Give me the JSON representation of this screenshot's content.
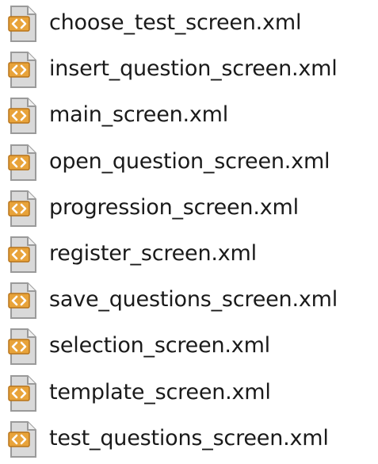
{
  "files": [
    {
      "name": "choose_test_screen.xml",
      "icon": "xml-file-icon"
    },
    {
      "name": "insert_question_screen.xml",
      "icon": "xml-file-icon"
    },
    {
      "name": "main_screen.xml",
      "icon": "xml-file-icon"
    },
    {
      "name": "open_question_screen.xml",
      "icon": "xml-file-icon"
    },
    {
      "name": "progression_screen.xml",
      "icon": "xml-file-icon"
    },
    {
      "name": "register_screen.xml",
      "icon": "xml-file-icon"
    },
    {
      "name": "save_questions_screen.xml",
      "icon": "xml-file-icon"
    },
    {
      "name": "selection_screen.xml",
      "icon": "xml-file-icon"
    },
    {
      "name": "template_screen.xml",
      "icon": "xml-file-icon"
    },
    {
      "name": "test_questions_screen.xml",
      "icon": "xml-file-icon"
    }
  ],
  "colors": {
    "icon_page": "#d9d9d9",
    "icon_page_border": "#9a9a9a",
    "icon_badge": "#e8a33a",
    "icon_badge_dark": "#b8741a",
    "icon_glyph": "#ffffff",
    "text": "#1a1a1a"
  }
}
